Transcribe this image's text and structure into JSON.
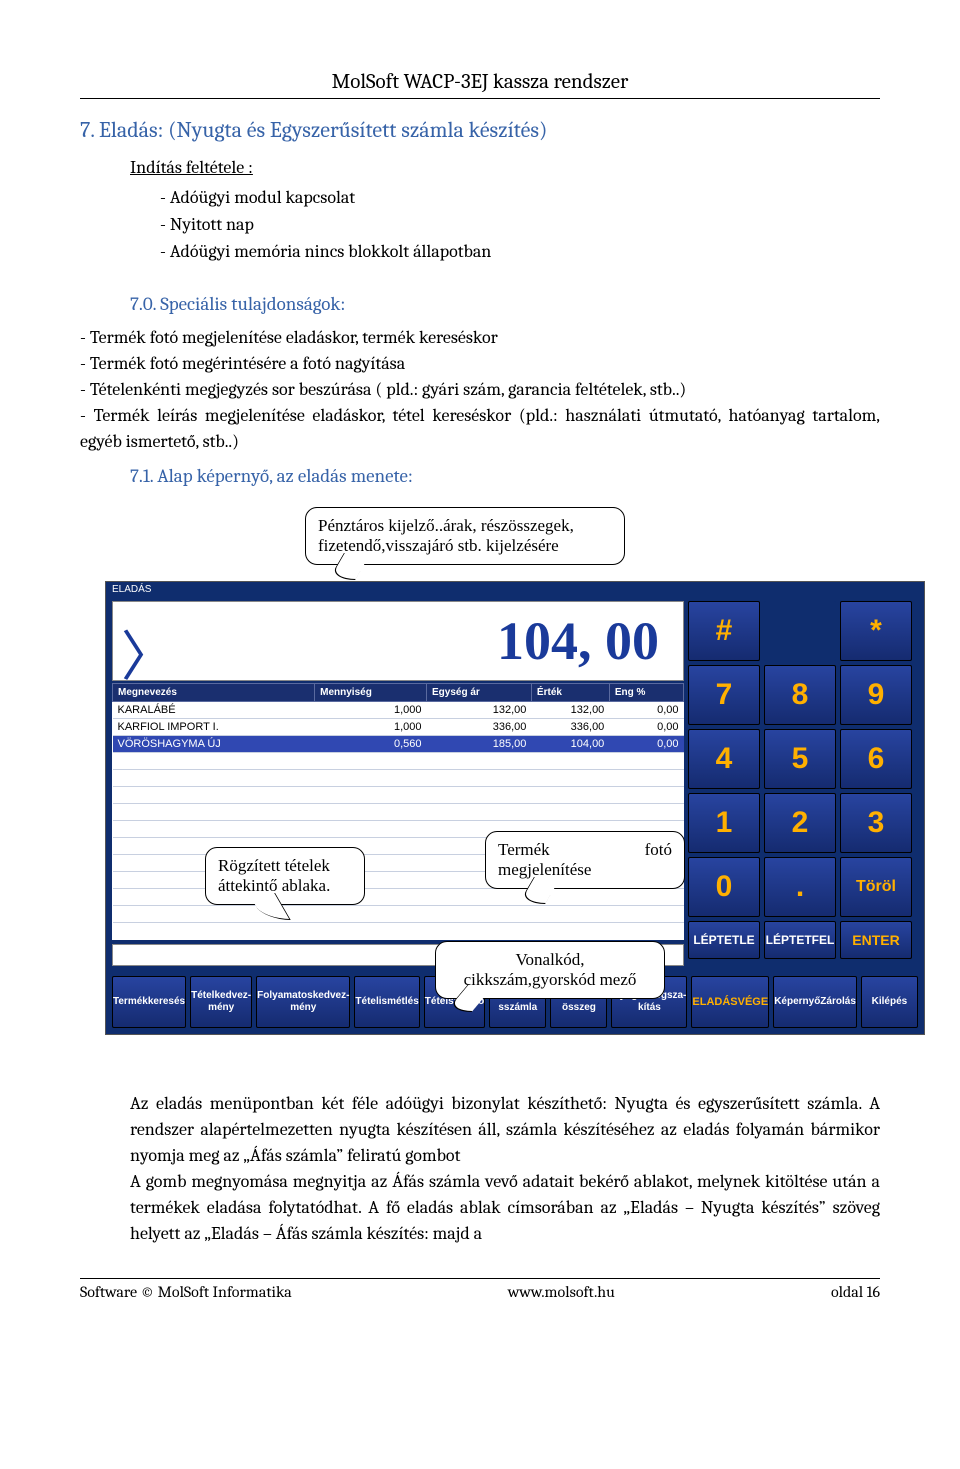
{
  "header": {
    "title": "MolSoft WACP-3EJ kassza rendszer"
  },
  "section": {
    "h2": "7. Eladás: (Nyugta és Egyszerűsített számla készítés)",
    "sub_u": "Indítás feltétele :",
    "bullets": [
      "Adóügyi modul kapcsolat",
      "Nyitott nap",
      "Adóügyi memória nincs blokkolt állapotban"
    ],
    "h3a": "7.0. Speciális tulajdonságok:",
    "feat": "- Termék fotó megjelenítése eladáskor, termék kereséskor\n- Termék fotó megérintésére a fotó nagyítása\n- Tételenkénti megjegyzés sor beszúrása ( pld.: gyári szám, garancia feltételek, stb..)\n- Termék leírás megjelenítése eladáskor, tétel kereséskor (pld.: használati útmutató, hatóanyag tartalom, egyéb ismertető, stb..)",
    "h3b": "7.1. Alap képernyő, az eladás menete:"
  },
  "callouts": {
    "c1": "Pénztáros kijelző..árak, részösszegek, fizetendő,visszajáró stb. kijelzésére",
    "c2": "Rögzített tételek áttekintő ablaka.",
    "c3": "Termék fotó megjelenítése",
    "c4": "Vonalkód, cikkszám,gyorskód mező"
  },
  "ui": {
    "title": "ELADÁS",
    "display": "104, 00",
    "headers": [
      "Megnevezés",
      "Mennyiség",
      "Egység ár",
      "Érték",
      "Eng %"
    ],
    "rows": [
      {
        "name": "KARALÁBÉ",
        "qty": "1,000",
        "unit": "132,00",
        "val": "132,00",
        "eng": "0,00",
        "sel": false
      },
      {
        "name": "KARFIOL IMPORT I.",
        "qty": "1,000",
        "unit": "336,00",
        "val": "336,00",
        "eng": "0,00",
        "sel": false
      },
      {
        "name": "VÖRÖSHAGYMA ÚJ",
        "qty": "0,560",
        "unit": "185,00",
        "val": "104,00",
        "eng": "0,00",
        "sel": true
      }
    ],
    "keypad_rows": [
      [
        "#",
        "",
        "*"
      ],
      [
        "7",
        "8",
        "9"
      ],
      [
        "4",
        "5",
        "6"
      ],
      [
        "1",
        "2",
        "3"
      ],
      [
        "0",
        ".",
        "Töröl"
      ]
    ],
    "small_keys": [
      "LÉPTET\nLE",
      "LÉPTET\nFEL",
      "ENTER"
    ],
    "bottom": [
      "Termék\nkeresés",
      "Tétel\nkedvez-\nmény",
      "Folyamatos\nkedvez-\nmény",
      "Tétel\nismétlés",
      "Tétel\nsztornó",
      "ÁFA-s\nszámla",
      "Rész-\nösszeg",
      "Nyugta\nmegsza-\nkítás",
      "ELADÁS\nVÉGE",
      "Képernyő\nZárolás",
      "Kilépés"
    ]
  },
  "body": "Az eladás menüpontban két féle adóügyi bizonylat készíthető: Nyugta és egyszerűsített számla. A rendszer alapértelmezetten nyugta készítésen áll, számla készítéséhez az eladás folyamán bármikor nyomja meg az „Áfás számla” feliratú gombot\nA gomb megnyomása megnyitja az Áfás számla vevő adatait bekérő ablakot, melynek kitöltése után a termékek eladása folytatódhat. A fő eladás ablak címsorában az „Eladás – Nyugta készítés” szöveg helyett az  „Eladás – Áfás számla készítés: majd a",
  "footer": {
    "left": "Software © MolSoft Informatika",
    "center": "www.molsoft.hu",
    "right": "oldal 16"
  }
}
